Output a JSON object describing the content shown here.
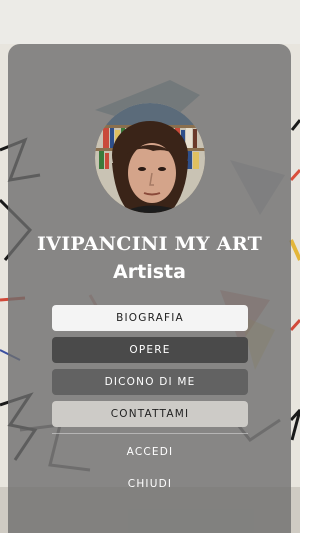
{
  "header": {
    "site_title": "IVIPANCINI MY ART",
    "subtitle": "Artista"
  },
  "profile": {
    "avatar_icon": "artist-portrait"
  },
  "menu": {
    "biografia": "BIOGRAFIA",
    "opere": "OPERE",
    "dicono": "DICONO DI ME",
    "contattami": "CONTATTAMI"
  },
  "actions": {
    "accedi": "ACCEDI",
    "chiudi": "CHIUDI"
  },
  "colors": {
    "overlay": "#6e6e6e",
    "button_light": "#f4f4f4",
    "button_dark": "#4a4a4a",
    "button_mid": "#626262",
    "button_beige": "#cdcbc7",
    "text": "#ffffff"
  }
}
